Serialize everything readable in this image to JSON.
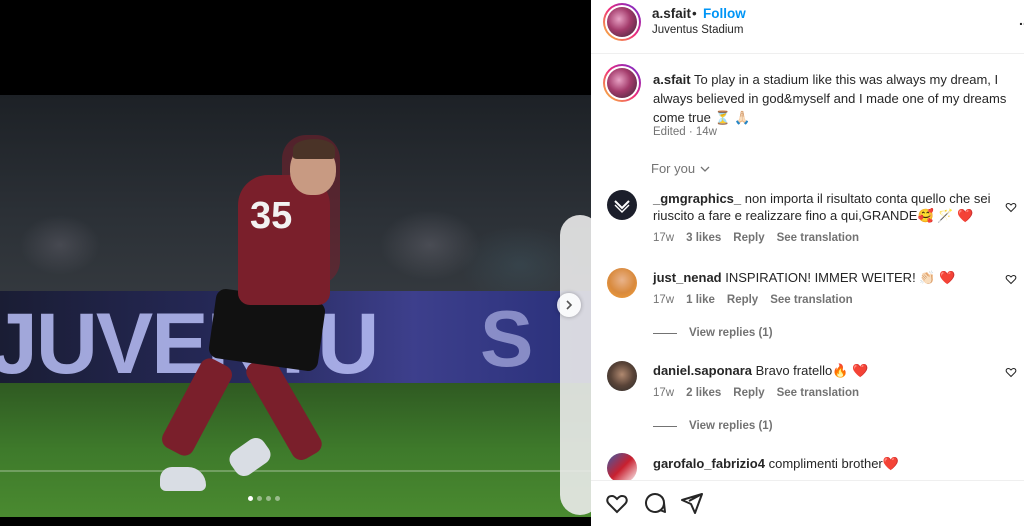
{
  "post": {
    "username": "a.sfait",
    "follow_label": "Follow",
    "separator": "•",
    "location": "Juventus Stadium",
    "more_label": "...",
    "caption_text": "To play in a stadium like this was always my dream, I always believed in god&myself and I made one of my dreams come true",
    "caption_emoji": "⏳ 🙏🏻",
    "edited_label": "Edited",
    "age": "14w",
    "carousel": {
      "total_slides": 4,
      "active_slide": 1
    },
    "photo_text": {
      "board_left": "JUVENTU",
      "board_right": "S"
    },
    "jersey_number": "35"
  },
  "for_you": {
    "label": "For you"
  },
  "comments": [
    {
      "username": "_gmgraphics_",
      "text": "non importa il risultato conta quello che sei riuscito a fare e realizzare fino a qui,GRANDE🥰 🪄 ❤️",
      "age": "17w",
      "likes": "3 likes",
      "reply": "Reply",
      "translation": "See translation",
      "avatar_icon": "gm-logo-icon"
    },
    {
      "username": "just_nenad",
      "text": "INSPIRATION! IMMER WEITER! 👏🏻 ❤️",
      "age": "17w",
      "likes": "1 like",
      "reply": "Reply",
      "translation": "See translation",
      "view_replies": "View replies (1)"
    },
    {
      "username": "daniel.saponara",
      "text": "Bravo fratello🔥 ❤️",
      "age": "17w",
      "likes": "2 likes",
      "reply": "Reply",
      "translation": "See translation",
      "view_replies": "View replies (1)"
    },
    {
      "username": "garofalo_fabrizio4",
      "text": "complimenti brother❤️"
    }
  ],
  "colors": {
    "link": "#0095f6",
    "heart_outline": "#262626",
    "meta": "#737373"
  },
  "actions": [
    "heart-icon",
    "comment-icon",
    "share-icon"
  ]
}
